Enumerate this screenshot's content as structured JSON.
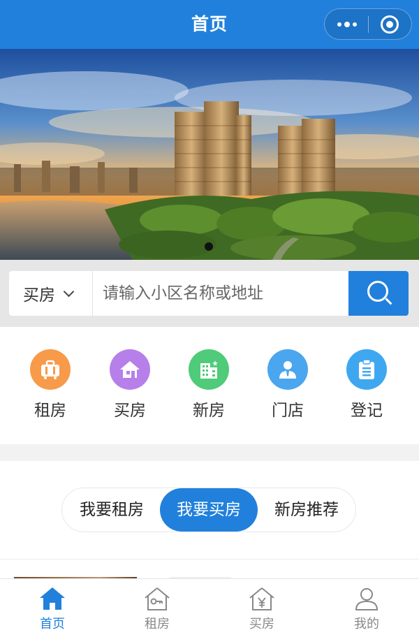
{
  "navbar": {
    "title": "首页",
    "more_icon": "more-dots-icon",
    "close_icon": "close-circle-icon",
    "background": "#2180dc"
  },
  "banner": {
    "description_icon": "banner-image",
    "indicator_count": 1
  },
  "search": {
    "select_value": "买房",
    "placeholder": "请输入小区名称或地址",
    "button_icon": "search-icon"
  },
  "categories": [
    {
      "label": "租房",
      "icon": "suitcase-icon",
      "color": "#f79a4a"
    },
    {
      "label": "买房",
      "icon": "house-icon",
      "color": "#b77fe9"
    },
    {
      "label": "新房",
      "icon": "building-icon",
      "color": "#4fcb7a"
    },
    {
      "label": "门店",
      "icon": "agent-icon",
      "color": "#4aa6ee"
    },
    {
      "label": "登记",
      "icon": "clipboard-icon",
      "color": "#3fa7f0"
    }
  ],
  "tabs": [
    {
      "label": "我要租房",
      "active": false
    },
    {
      "label": "我要买房",
      "active": true
    },
    {
      "label": "新房推荐",
      "active": false
    }
  ],
  "tabbar": [
    {
      "label": "首页",
      "icon": "home-icon",
      "active": true
    },
    {
      "label": "租房",
      "icon": "house-key-icon",
      "active": false
    },
    {
      "label": "买房",
      "icon": "house-yen-icon",
      "active": false
    },
    {
      "label": "我的",
      "icon": "user-icon",
      "active": false
    }
  ],
  "colors": {
    "accent": "#2180dc",
    "inactive": "#888888"
  }
}
